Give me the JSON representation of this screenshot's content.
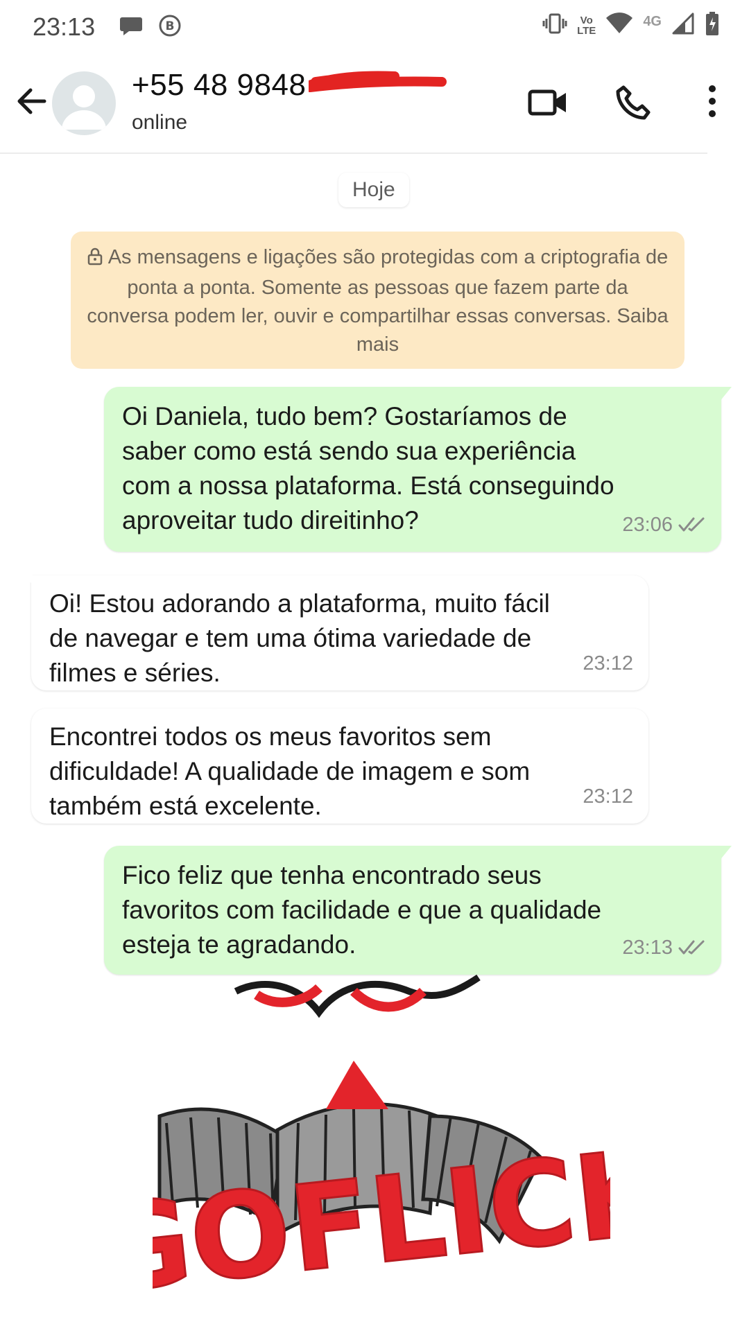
{
  "status_bar": {
    "time": "23:13",
    "lte_top": "Vo",
    "lte_bottom": "LTE",
    "network_label": "4G",
    "icons": [
      "chat-bubble-icon",
      "b-circle-icon",
      "vibrate-icon",
      "volte-icon",
      "wifi-icon",
      "signal-icon",
      "battery-charging-icon"
    ]
  },
  "header": {
    "contact_name": "+55 48 9848",
    "status": "online",
    "actions": [
      "back-arrow-icon",
      "video-call-icon",
      "phone-icon",
      "more-vert-icon"
    ]
  },
  "chat": {
    "date_chip": "Hoje",
    "encryption_notice": "As mensagens e ligações são protegidas com a criptografia de ponta a ponta. Somente as pessoas que fazem parte da conversa podem ler, ouvir e compartilhar essas conversas. Saiba mais",
    "messages": [
      {
        "direction": "out",
        "text": "Oi Daniela, tudo bem? Gostaríamos de\nsaber como está sendo sua experiência\ncom a nossa plataforma. Está conseguindo\naproveitar tudo direitinho?",
        "time": "23:06",
        "status": "read"
      },
      {
        "direction": "in",
        "text": "Oi! Estou adorando a plataforma, muito fácil\nde navegar e tem uma ótima variedade de\nfilmes e séries.",
        "time": "23:12"
      },
      {
        "direction": "in",
        "text": "Encontrei todos os meus favoritos sem\ndificuldade! A qualidade de imagem e som\ntambém está excelente.",
        "time": "23:12"
      },
      {
        "direction": "out",
        "text": "Fico feliz que tenha encontrado seus\nfavoritos com facilidade e que a qualidade\nesteja te agradando.",
        "time": "23:13",
        "status": "read"
      }
    ]
  },
  "wallpaper": {
    "logo_text": "GOFLICK",
    "brand_red": "#e3242b"
  },
  "colors": {
    "outgoing_bubble": "#d8fbd2",
    "incoming_bubble": "#ffffff",
    "notice_bg": "#fde9c5",
    "read_tick": "#8a8a8a"
  }
}
